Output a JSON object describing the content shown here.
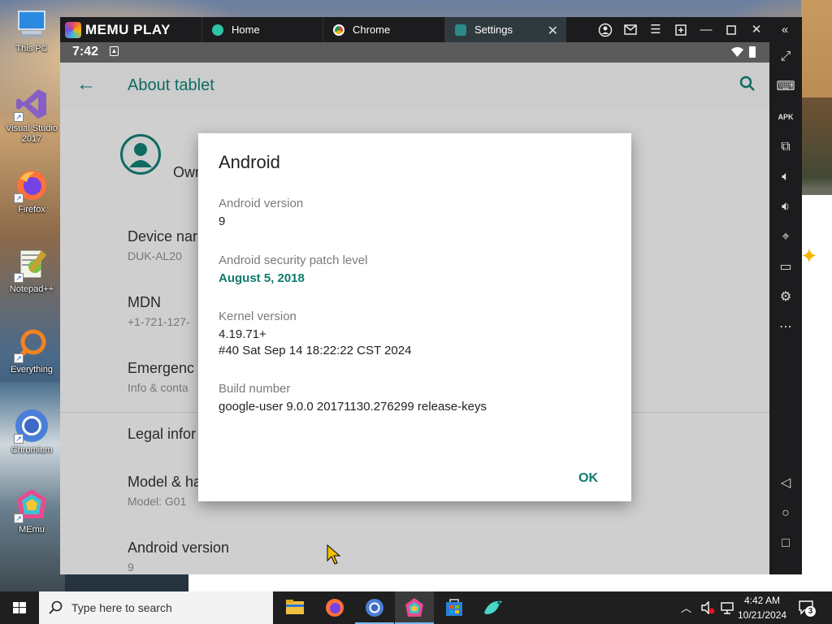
{
  "desktop": {
    "icons": [
      {
        "label": "This PC"
      },
      {
        "label": "Visual Studio 2017"
      },
      {
        "label": "Firefox"
      },
      {
        "label": "Notepad++"
      },
      {
        "label": "Everything"
      },
      {
        "label": "Chromium"
      },
      {
        "label": "MEmu"
      }
    ]
  },
  "memu": {
    "logo": "MEMU PLAY",
    "tabs": [
      {
        "label": "Home"
      },
      {
        "label": "Chrome"
      },
      {
        "label": "Settings"
      }
    ]
  },
  "android": {
    "status_time": "7:42",
    "app_bar_title": "About tablet",
    "rows": [
      {
        "title": "Own",
        "sub": ""
      },
      {
        "title": "Device nar",
        "sub": "DUK-AL20"
      },
      {
        "title": "MDN",
        "sub": "+1-721-127-"
      },
      {
        "title": "Emergenc",
        "sub": "Info & conta"
      },
      {
        "title": "Legal infor",
        "sub": ""
      },
      {
        "title": "Model & ha",
        "sub": "Model: G01"
      },
      {
        "title": "Android version",
        "sub": "9"
      }
    ],
    "dialog": {
      "title": "Android",
      "fields": [
        {
          "label": "Android version",
          "value": "9"
        },
        {
          "label": "Android security patch level",
          "value": "August 5, 2018"
        },
        {
          "label": "Kernel version",
          "value_line1": "4.19.71+",
          "value_line2": "#40 Sat Sep 14 18:22:22 CST 2024"
        },
        {
          "label": "Build number",
          "value": "google-user 9.0.0 20171130.276299 release-keys"
        }
      ],
      "ok_label": "OK"
    }
  },
  "taskbar": {
    "search_placeholder": "Type here to search",
    "clock_time": "4:42 AM",
    "clock_date": "10/21/2024",
    "notification_count": "3"
  },
  "colors": {
    "accent": "#0f7b6c",
    "memu_chrome": "#1c1c1e",
    "taskbar": "#1f1f1f"
  }
}
